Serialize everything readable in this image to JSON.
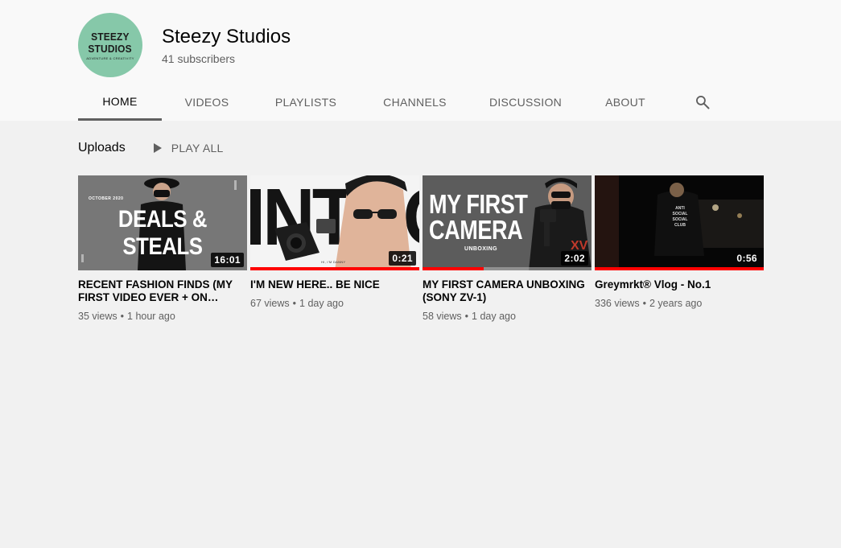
{
  "channel": {
    "name": "Steezy Studios",
    "subscribers": "41 subscribers",
    "avatar": {
      "line1": "STEEZY",
      "line2": "STUDIOS",
      "line3": "ADVENTURE & CREATIVITY",
      "color": "#86c8a9"
    }
  },
  "tabs": [
    {
      "label": "HOME",
      "active": true
    },
    {
      "label": "VIDEOS"
    },
    {
      "label": "PLAYLISTS"
    },
    {
      "label": "CHANNELS"
    },
    {
      "label": "DISCUSSION"
    },
    {
      "label": "ABOUT"
    }
  ],
  "search_icon": "search-icon",
  "section": {
    "title": "Uploads",
    "play_all": "PLAY ALL"
  },
  "videos": [
    {
      "title": "RECENT FASHION FINDS (MY FIRST VIDEO EVER + ON…",
      "views": "35 views",
      "age": "1 hour ago",
      "duration": "16:01",
      "thumb_text": "DEALS & STEALS",
      "thumb_small": "OCTOBER 2020",
      "progress": 0
    },
    {
      "title": "I'M NEW HERE.. BE NICE",
      "views": "67 views",
      "age": "1 day ago",
      "duration": "0:21",
      "thumb_text": "INTRO",
      "thumb_small": "HI, I'M DANNY",
      "progress": 1.0
    },
    {
      "title": "MY FIRST CAMERA UNBOXING (SONY ZV-1)",
      "views": "58 views",
      "age": "1 day ago",
      "duration": "2:02",
      "thumb_text_1": "MY FIRST",
      "thumb_text_2": "CAMERA",
      "thumb_small": "UNBOXING",
      "progress": 0.36
    },
    {
      "title": "Greymrkt® Vlog - No.1",
      "views": "336 views",
      "age": "2 years ago",
      "duration": "0:56",
      "thumb_small": "ANTI SOCIAL SOCIAL CLUB",
      "progress": 1.0
    }
  ],
  "colors": {
    "accent": "#ff0000",
    "secondary_text": "#606060",
    "background": "#f1f1f1"
  }
}
